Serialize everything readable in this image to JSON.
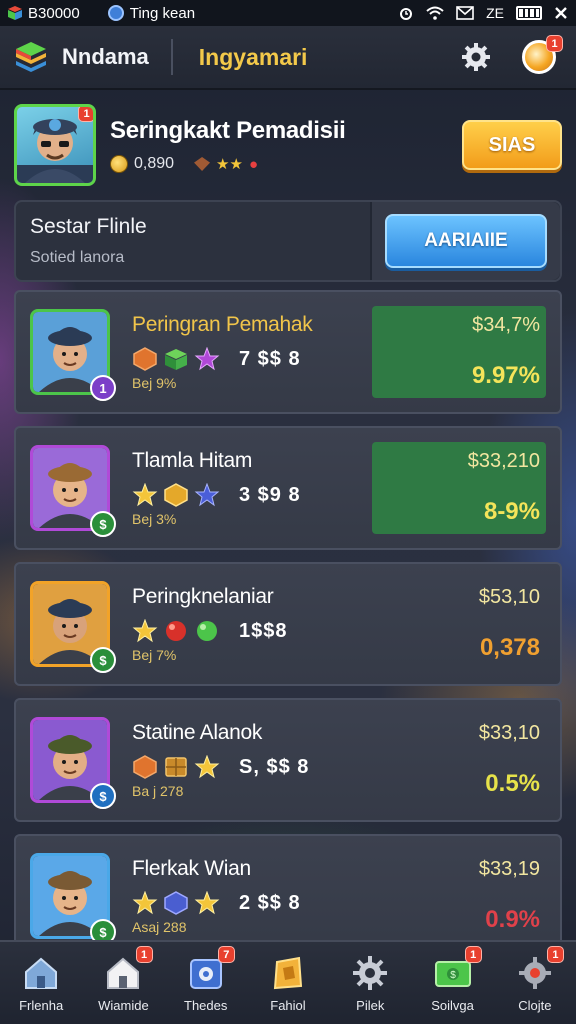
{
  "status_bar": {
    "left_text": "B30000",
    "app_text": "Ting kean",
    "right_text": "ZE"
  },
  "header": {
    "app_name": "Nndama",
    "subtitle": "Ingyamari",
    "coin_badge": "1"
  },
  "profile": {
    "name": "Seringkakt Pemadisii",
    "coins": "0,890",
    "avatar_badge": "1",
    "action_label": "SIAS"
  },
  "search": {
    "title": "Sestar Flinle",
    "subtitle": "Sotied lanora",
    "button_label": "AARIAIIE"
  },
  "list": [
    {
      "name": "Peringran Pemahak",
      "score": "7 $$ 8",
      "sub": "Bej 9%",
      "price": "$34,7%",
      "pct": "9.97%",
      "rank": "1",
      "highlight": true,
      "name_color": "#f1c54a",
      "pct_color": "#f4e45a",
      "frame_color": "#4cc54a",
      "rank_color": "#7b3fc8",
      "icons": [
        "hex-orange",
        "cube-green",
        "star-purple"
      ]
    },
    {
      "name": "Tlamla Hitam",
      "score": "3 $9 8",
      "sub": "Bej 3%",
      "price": "$33,210",
      "pct": "8-9%",
      "rank": "$",
      "highlight": true,
      "name_color": "#ffffff",
      "pct_color": "#f4e45a",
      "frame_color": "#b04ad8",
      "rank_color": "#2a8f3a",
      "icons": [
        "star-gold",
        "hex-gold",
        "star-blue"
      ]
    },
    {
      "name": "Peringknelaniar",
      "score": "1$$8",
      "sub": "Bej 7%",
      "price": "$53,10",
      "pct": "0,378",
      "rank": "$",
      "highlight": false,
      "name_color": "#ffffff",
      "pct_color": "#f0a030",
      "frame_color": "#f2a328",
      "rank_color": "#2a8f3a",
      "icons": [
        "star-gold",
        "orb-red",
        "orb-green"
      ]
    },
    {
      "name": "Statine Alanok",
      "score": "S, $$ 8",
      "sub": "Ba j 278",
      "price": "$33,10",
      "pct": "0.5%",
      "rank": "$",
      "highlight": false,
      "name_color": "#ffffff",
      "pct_color": "#e6e24a",
      "frame_color": "#b04ad8",
      "rank_color": "#1f6fc0",
      "icons": [
        "hex-orange",
        "crate-gold",
        "star-gold"
      ]
    },
    {
      "name": "Flerkak Wian",
      "score": "2 $$ 8",
      "sub": "Asaj 288",
      "price": "$33,19",
      "pct": "0.9%",
      "rank": "$",
      "highlight": false,
      "name_color": "#ffffff",
      "pct_color": "#e0414a",
      "frame_color": "#4aa8e8",
      "rank_color": "#2a8f3a",
      "icons": [
        "star-gold",
        "hex-blue",
        "star-gold"
      ]
    }
  ],
  "bottom_nav": [
    {
      "label": "Frlenha",
      "icon": "home-icon",
      "badge": ""
    },
    {
      "label": "Wiamide",
      "icon": "house-icon",
      "badge": "1"
    },
    {
      "label": "Thedes",
      "icon": "shield-icon",
      "badge": "7"
    },
    {
      "label": "Fahiol",
      "icon": "chest-icon",
      "badge": ""
    },
    {
      "label": "Pilek",
      "icon": "gear-icon",
      "badge": ""
    },
    {
      "label": "Soilvga",
      "icon": "cash-icon",
      "badge": "1"
    },
    {
      "label": "Clojte",
      "icon": "cog-icon",
      "badge": "1"
    }
  ]
}
